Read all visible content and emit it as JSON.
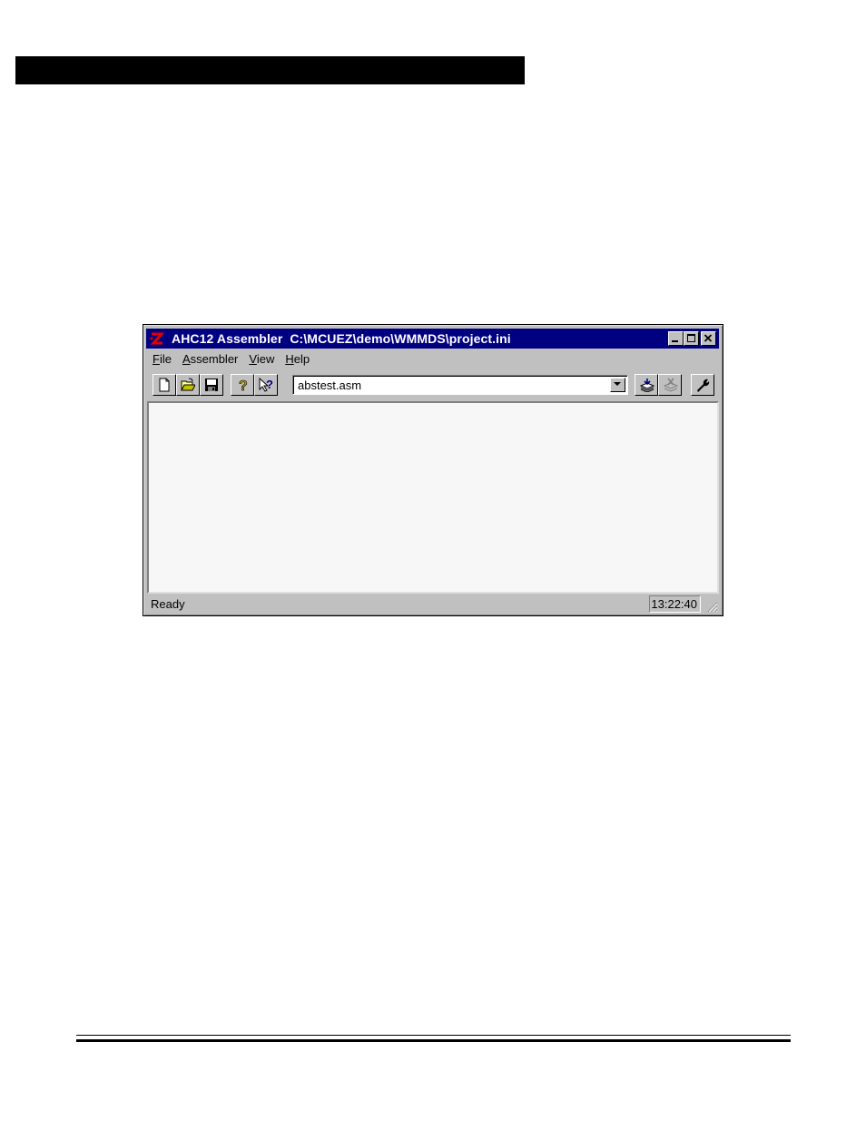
{
  "window": {
    "title": "AHC12 Assembler  C:\\MCUEZ\\demo\\WMMDS\\project.ini"
  },
  "menu": {
    "items": [
      {
        "first": "F",
        "rest": "ile"
      },
      {
        "first": "A",
        "rest": "ssembler"
      },
      {
        "first": "V",
        "rest": "iew"
      },
      {
        "first": "H",
        "rest": "elp"
      }
    ]
  },
  "toolbar": {
    "file_combo_value": "abstest.asm"
  },
  "status": {
    "text": "Ready",
    "time": "13:22:40"
  },
  "colors": {
    "titlebar": "#000080",
    "chrome": "#c0c0c0",
    "client_bg": "#f7f7f7"
  }
}
